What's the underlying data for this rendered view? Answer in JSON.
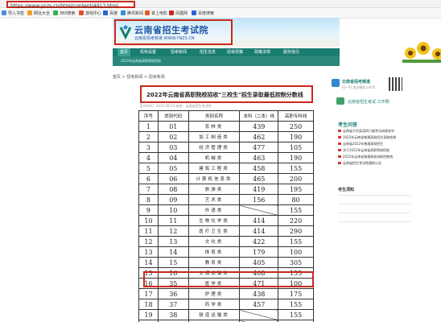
{
  "browser": {
    "url": "https://www.ynzs.cn/html/content/4913.html",
    "bookmarks": [
      {
        "label": "导入书签",
        "color": "#4a8de0"
      },
      {
        "label": "网址大全",
        "color": "#f0a020"
      },
      {
        "label": "360搜索",
        "color": "#2fb34f"
      },
      {
        "label": "游戏中心",
        "color": "#e0502a"
      },
      {
        "label": "百度",
        "color": "#2a63d4"
      },
      {
        "label": "腾讯新闻",
        "color": "#2a90e0"
      },
      {
        "label": "掌上电影",
        "color": "#e85a2a"
      },
      {
        "label": "凤凰网",
        "color": "#c72828"
      },
      {
        "label": "百度搜索",
        "color": "#2a63d4"
      }
    ]
  },
  "site": {
    "title": "云南省招生考试院",
    "subtitle": "云南省招考频道 WWW.YNZS.CN"
  },
  "nav": {
    "items": [
      "首页",
      "机构设置",
      "招考新闻",
      "招生信息",
      "招考政策",
      "政策法规",
      "服务指引"
    ],
    "subline": "2022年云南省高职院校招收"
  },
  "breadcrumb": "首页 > 招考新闻 > 招考新闻",
  "article": {
    "title": "2022年云南省高职院校招收\"三校生\"招生录取最低控制分数线",
    "meta": "发布时间：2022-08-24    来源：云南省招生考试院"
  },
  "table": {
    "headers": [
      "序号",
      "类别代码",
      "类别名称",
      "本科（二本）线",
      "高职专科线"
    ],
    "rows": [
      [
        "1",
        "01",
        "农林类",
        "439",
        "250"
      ],
      [
        "2",
        "02",
        "加工制造类",
        "462",
        "190"
      ],
      [
        "3",
        "03",
        "经济管理类",
        "477",
        "105"
      ],
      [
        "4",
        "04",
        "机械类",
        "463",
        "190"
      ],
      [
        "5",
        "05",
        "建筑工程类",
        "458",
        "155"
      ],
      [
        "6",
        "06",
        "计算机信息类",
        "465",
        "200"
      ],
      [
        "7",
        "08",
        "旅游类",
        "419",
        "195"
      ],
      [
        "8",
        "09",
        "艺术类",
        "156",
        "80"
      ],
      [
        "9",
        "10",
        "外语类",
        "",
        "155"
      ],
      [
        "10",
        "11",
        "生物化学类",
        "414",
        "220"
      ],
      [
        "11",
        "12",
        "医疗卫生类",
        "414",
        "290"
      ],
      [
        "12",
        "13",
        "文化类",
        "422",
        "155"
      ],
      [
        "13",
        "14",
        "体育类",
        "179",
        "100"
      ],
      [
        "14",
        "15",
        "教育类",
        "405",
        "305"
      ],
      [
        "15",
        "16",
        "交通运输类",
        "408",
        "155"
      ],
      [
        "16",
        "35",
        "医学类",
        "471",
        "100"
      ],
      [
        "17",
        "36",
        "护理类",
        "438",
        "175"
      ],
      [
        "18",
        "37",
        "药学类",
        "457",
        "155"
      ],
      [
        "19",
        "38",
        "铁道运输类",
        "",
        "155"
      ],
      [
        "20",
        "39",
        "水利水电类",
        "",
        "155"
      ]
    ],
    "highlighted_row": "16"
  },
  "sidebar": {
    "app_title": "云南省招考频道",
    "app_note": "扫一扫 关注微信公众号",
    "work_label": "云南省招生考试 工作网",
    "news_head": "考生问答",
    "news": [
      "云南省大学英语四六级考试成绩发布",
      "2022年云南省普通高校招生录取结果",
      "云南省2022年普通高校招生",
      "关于2022年云南省高职院校招收",
      "2022年云南省普通高校录取控制线",
      "云南省招生考试院通知公告"
    ],
    "notice_head": "考生须知"
  }
}
